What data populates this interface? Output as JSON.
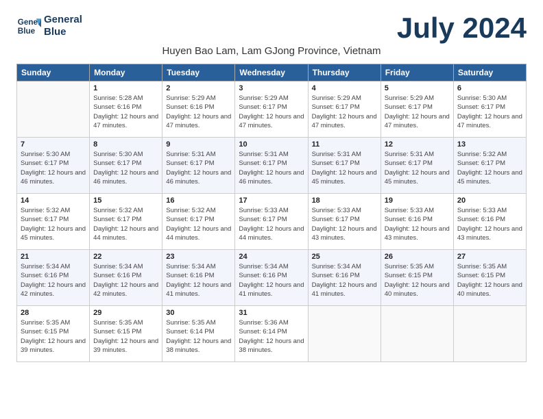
{
  "header": {
    "logo_line1": "General",
    "logo_line2": "Blue",
    "month_year": "July 2024",
    "location": "Huyen Bao Lam, Lam GJong Province, Vietnam"
  },
  "days_of_week": [
    "Sunday",
    "Monday",
    "Tuesday",
    "Wednesday",
    "Thursday",
    "Friday",
    "Saturday"
  ],
  "weeks": [
    [
      {
        "day": "",
        "empty": true
      },
      {
        "day": "1",
        "sunrise": "5:28 AM",
        "sunset": "6:16 PM",
        "daylight": "12 hours and 47 minutes."
      },
      {
        "day": "2",
        "sunrise": "5:29 AM",
        "sunset": "6:16 PM",
        "daylight": "12 hours and 47 minutes."
      },
      {
        "day": "3",
        "sunrise": "5:29 AM",
        "sunset": "6:17 PM",
        "daylight": "12 hours and 47 minutes."
      },
      {
        "day": "4",
        "sunrise": "5:29 AM",
        "sunset": "6:17 PM",
        "daylight": "12 hours and 47 minutes."
      },
      {
        "day": "5",
        "sunrise": "5:29 AM",
        "sunset": "6:17 PM",
        "daylight": "12 hours and 47 minutes."
      },
      {
        "day": "6",
        "sunrise": "5:30 AM",
        "sunset": "6:17 PM",
        "daylight": "12 hours and 47 minutes."
      }
    ],
    [
      {
        "day": "7",
        "sunrise": "5:30 AM",
        "sunset": "6:17 PM",
        "daylight": "12 hours and 46 minutes."
      },
      {
        "day": "8",
        "sunrise": "5:30 AM",
        "sunset": "6:17 PM",
        "daylight": "12 hours and 46 minutes."
      },
      {
        "day": "9",
        "sunrise": "5:31 AM",
        "sunset": "6:17 PM",
        "daylight": "12 hours and 46 minutes."
      },
      {
        "day": "10",
        "sunrise": "5:31 AM",
        "sunset": "6:17 PM",
        "daylight": "12 hours and 46 minutes."
      },
      {
        "day": "11",
        "sunrise": "5:31 AM",
        "sunset": "6:17 PM",
        "daylight": "12 hours and 45 minutes."
      },
      {
        "day": "12",
        "sunrise": "5:31 AM",
        "sunset": "6:17 PM",
        "daylight": "12 hours and 45 minutes."
      },
      {
        "day": "13",
        "sunrise": "5:32 AM",
        "sunset": "6:17 PM",
        "daylight": "12 hours and 45 minutes."
      }
    ],
    [
      {
        "day": "14",
        "sunrise": "5:32 AM",
        "sunset": "6:17 PM",
        "daylight": "12 hours and 45 minutes."
      },
      {
        "day": "15",
        "sunrise": "5:32 AM",
        "sunset": "6:17 PM",
        "daylight": "12 hours and 44 minutes."
      },
      {
        "day": "16",
        "sunrise": "5:32 AM",
        "sunset": "6:17 PM",
        "daylight": "12 hours and 44 minutes."
      },
      {
        "day": "17",
        "sunrise": "5:33 AM",
        "sunset": "6:17 PM",
        "daylight": "12 hours and 44 minutes."
      },
      {
        "day": "18",
        "sunrise": "5:33 AM",
        "sunset": "6:17 PM",
        "daylight": "12 hours and 43 minutes."
      },
      {
        "day": "19",
        "sunrise": "5:33 AM",
        "sunset": "6:16 PM",
        "daylight": "12 hours and 43 minutes."
      },
      {
        "day": "20",
        "sunrise": "5:33 AM",
        "sunset": "6:16 PM",
        "daylight": "12 hours and 43 minutes."
      }
    ],
    [
      {
        "day": "21",
        "sunrise": "5:34 AM",
        "sunset": "6:16 PM",
        "daylight": "12 hours and 42 minutes."
      },
      {
        "day": "22",
        "sunrise": "5:34 AM",
        "sunset": "6:16 PM",
        "daylight": "12 hours and 42 minutes."
      },
      {
        "day": "23",
        "sunrise": "5:34 AM",
        "sunset": "6:16 PM",
        "daylight": "12 hours and 41 minutes."
      },
      {
        "day": "24",
        "sunrise": "5:34 AM",
        "sunset": "6:16 PM",
        "daylight": "12 hours and 41 minutes."
      },
      {
        "day": "25",
        "sunrise": "5:34 AM",
        "sunset": "6:16 PM",
        "daylight": "12 hours and 41 minutes."
      },
      {
        "day": "26",
        "sunrise": "5:35 AM",
        "sunset": "6:15 PM",
        "daylight": "12 hours and 40 minutes."
      },
      {
        "day": "27",
        "sunrise": "5:35 AM",
        "sunset": "6:15 PM",
        "daylight": "12 hours and 40 minutes."
      }
    ],
    [
      {
        "day": "28",
        "sunrise": "5:35 AM",
        "sunset": "6:15 PM",
        "daylight": "12 hours and 39 minutes."
      },
      {
        "day": "29",
        "sunrise": "5:35 AM",
        "sunset": "6:15 PM",
        "daylight": "12 hours and 39 minutes."
      },
      {
        "day": "30",
        "sunrise": "5:35 AM",
        "sunset": "6:14 PM",
        "daylight": "12 hours and 38 minutes."
      },
      {
        "day": "31",
        "sunrise": "5:36 AM",
        "sunset": "6:14 PM",
        "daylight": "12 hours and 38 minutes."
      },
      {
        "day": "",
        "empty": true
      },
      {
        "day": "",
        "empty": true
      },
      {
        "day": "",
        "empty": true
      }
    ]
  ],
  "labels": {
    "sunrise_prefix": "Sunrise: ",
    "sunset_prefix": "Sunset: ",
    "daylight_prefix": "Daylight: "
  }
}
